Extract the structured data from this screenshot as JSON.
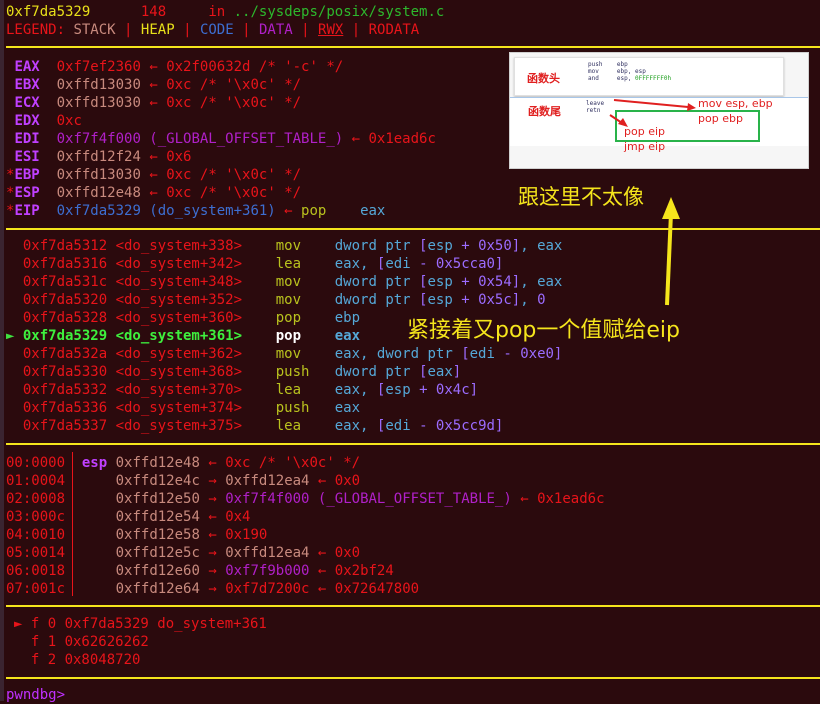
{
  "source_line": {
    "address": "0xf7da5329",
    "line_no": "148",
    "in_word": "in",
    "path": "../sysdeps/posix/system.c"
  },
  "legend": {
    "label": "LEGEND:",
    "items": [
      "STACK",
      "HEAP",
      "CODE",
      "DATA",
      "RWX",
      "RODATA"
    ],
    "sep": "|"
  },
  "registers": [
    {
      "star": " ",
      "name": "EAX",
      "value": "0xf7ef2360",
      "arrow": "←",
      "target": "0x2f00632d /* '-c' */"
    },
    {
      "star": " ",
      "name": "EBX",
      "value": "0xffd13030",
      "arrow": "←",
      "target": "0xc /* '\\x0c' */"
    },
    {
      "star": " ",
      "name": "ECX",
      "value": "0xffd13030",
      "arrow": "←",
      "target": "0xc /* '\\x0c' */"
    },
    {
      "star": " ",
      "name": "EDX",
      "value": "0xc",
      "arrow": "",
      "target": ""
    },
    {
      "star": " ",
      "name": "EDI",
      "value": "0xf7f4f000 (_GLOBAL_OFFSET_TABLE_)",
      "arrow": "←",
      "target": "0x1ead6c"
    },
    {
      "star": " ",
      "name": "ESI",
      "value": "0xffd12f24",
      "arrow": "←",
      "target": "0x6"
    },
    {
      "star": "*",
      "name": "EBP",
      "value": "0xffd13030",
      "arrow": "←",
      "target": "0xc /* '\\x0c' */"
    },
    {
      "star": "*",
      "name": "ESP",
      "value": "0xffd12e48",
      "arrow": "←",
      "target": "0xc /* '\\x0c' */"
    },
    {
      "star": "*",
      "name": "EIP",
      "value": "0xf7da5329 (do_system+361)",
      "arrow": "←",
      "target_op": "pop",
      "target_arg": "eax"
    }
  ],
  "disasm": [
    {
      "addr": "0xf7da5312",
      "sym": "<do_system+338>",
      "op": "mov",
      "args": [
        [
          "arg",
          "dword ptr "
        ],
        [
          "num",
          "["
        ],
        [
          "arg",
          "esp"
        ],
        [
          "num",
          " + 0x50]"
        ],
        [
          "arg",
          ", eax"
        ]
      ]
    },
    {
      "addr": "0xf7da5316",
      "sym": "<do_system+342>",
      "op": "lea",
      "args": [
        [
          "arg",
          "eax, "
        ],
        [
          "num",
          "["
        ],
        [
          "arg",
          "edi"
        ],
        [
          "num",
          " - 0x5cca0]"
        ]
      ]
    },
    {
      "addr": "0xf7da531c",
      "sym": "<do_system+348>",
      "op": "mov",
      "args": [
        [
          "arg",
          "dword ptr "
        ],
        [
          "num",
          "["
        ],
        [
          "arg",
          "esp"
        ],
        [
          "num",
          " + 0x54]"
        ],
        [
          "arg",
          ", eax"
        ]
      ]
    },
    {
      "addr": "0xf7da5320",
      "sym": "<do_system+352>",
      "op": "mov",
      "args": [
        [
          "arg",
          "dword ptr "
        ],
        [
          "num",
          "["
        ],
        [
          "arg",
          "esp"
        ],
        [
          "num",
          " + 0x5c]"
        ],
        [
          "arg",
          ", "
        ],
        [
          "num",
          "0"
        ]
      ]
    },
    {
      "addr": "0xf7da5328",
      "sym": "<do_system+360>",
      "op": "pop",
      "args": [
        [
          "arg",
          "ebp"
        ]
      ]
    },
    {
      "addr": "0xf7da5329",
      "sym": "<do_system+361>",
      "op": "pop",
      "args": [
        [
          "arg",
          "eax"
        ]
      ],
      "current": true
    },
    {
      "addr": "0xf7da532a",
      "sym": "<do_system+362>",
      "op": "mov",
      "args": [
        [
          "arg",
          "eax, dword ptr "
        ],
        [
          "num",
          "["
        ],
        [
          "arg",
          "edi"
        ],
        [
          "num",
          " - 0xe0]"
        ]
      ]
    },
    {
      "addr": "0xf7da5330",
      "sym": "<do_system+368>",
      "op": "push",
      "args": [
        [
          "arg",
          "dword ptr "
        ],
        [
          "num",
          "["
        ],
        [
          "arg",
          "eax"
        ],
        [
          "num",
          "]"
        ]
      ]
    },
    {
      "addr": "0xf7da5332",
      "sym": "<do_system+370>",
      "op": "lea",
      "args": [
        [
          "arg",
          "eax, "
        ],
        [
          "num",
          "["
        ],
        [
          "arg",
          "esp"
        ],
        [
          "num",
          " + 0x4c]"
        ]
      ]
    },
    {
      "addr": "0xf7da5336",
      "sym": "<do_system+374>",
      "op": "push",
      "args": [
        [
          "arg",
          "eax"
        ]
      ]
    },
    {
      "addr": "0xf7da5337",
      "sym": "<do_system+375>",
      "op": "lea",
      "args": [
        [
          "arg",
          "eax, "
        ],
        [
          "num",
          "["
        ],
        [
          "arg",
          "edi"
        ],
        [
          "num",
          " - 0x5cc9d]"
        ]
      ]
    }
  ],
  "current_marker": "►",
  "stack": [
    {
      "idx": "00:0000",
      "reg": "esp",
      "addr": "0xffd12e48",
      "chain": [
        [
          "red",
          "← 0xc /* '\\x0c' */"
        ]
      ]
    },
    {
      "idx": "01:0004",
      "reg": "",
      "addr": "0xffd12e4c",
      "chain": [
        [
          "red",
          "→ "
        ],
        [
          "stack",
          "0xffd12ea4"
        ],
        [
          "red",
          " ← 0x0"
        ]
      ]
    },
    {
      "idx": "02:0008",
      "reg": "",
      "addr": "0xffd12e50",
      "chain": [
        [
          "red",
          "→ "
        ],
        [
          "data",
          "0xf7f4f000 (_GLOBAL_OFFSET_TABLE_)"
        ],
        [
          "red",
          " ← 0x1ead6c"
        ]
      ]
    },
    {
      "idx": "03:000c",
      "reg": "",
      "addr": "0xffd12e54",
      "chain": [
        [
          "red",
          "← 0x4"
        ]
      ]
    },
    {
      "idx": "04:0010",
      "reg": "",
      "addr": "0xffd12e58",
      "chain": [
        [
          "red",
          "← 0x190"
        ]
      ]
    },
    {
      "idx": "05:0014",
      "reg": "",
      "addr": "0xffd12e5c",
      "chain": [
        [
          "red",
          "→ "
        ],
        [
          "stack",
          "0xffd12ea4"
        ],
        [
          "red",
          " ← 0x0"
        ]
      ]
    },
    {
      "idx": "06:0018",
      "reg": "",
      "addr": "0xffd12e60",
      "chain": [
        [
          "red",
          "→ "
        ],
        [
          "data",
          "0xf7f9b000"
        ],
        [
          "red",
          " ← 0x2bf24"
        ]
      ]
    },
    {
      "idx": "07:001c",
      "reg": "",
      "addr": "0xffd12e64",
      "chain": [
        [
          "red",
          "→ 0xf7d7200c ← 0x72647800"
        ]
      ]
    }
  ],
  "backtrace": [
    {
      "marker": "►",
      "text": "f 0 0xf7da5329 do_system+361"
    },
    {
      "marker": " ",
      "text": "f 1 0x62626262"
    },
    {
      "marker": " ",
      "text": "f 2 0x8048720"
    }
  ],
  "prompt": "pwndbg>",
  "embedded_image": {
    "head_label": "函数头",
    "tail_label": "函数尾",
    "head_asm": [
      [
        "push",
        "ebp"
      ],
      [
        "mov",
        "ebp, esp"
      ],
      [
        "and",
        "esp, 0FFFFFFF0h"
      ]
    ],
    "tail_asm": [
      [
        "leave",
        ""
      ],
      [
        "retn",
        ""
      ]
    ],
    "annotations": [
      "mov esp, ebp",
      "pop ebp",
      "pop eip",
      "jmp eip"
    ]
  },
  "annotations": {
    "top_note": "跟这里不太像",
    "mid_note": "紧接着又pop一个值赋给eip"
  },
  "colors": {
    "background": "#2b0a0d",
    "separator": "#f5e51c",
    "red": "#e8141a",
    "register_name": "#c040ff",
    "current_line": "#3ef03e"
  }
}
